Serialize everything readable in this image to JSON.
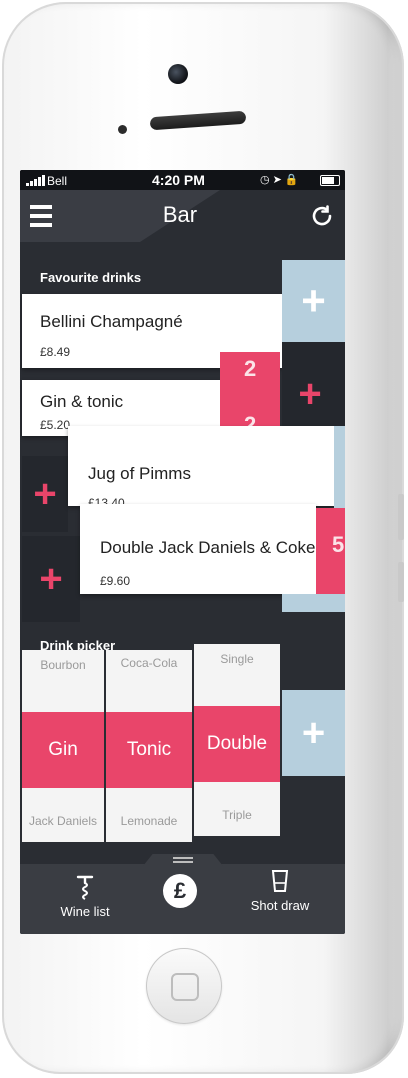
{
  "status_bar": {
    "carrier": "Bell",
    "time": "4:20 PM"
  },
  "nav": {
    "title": "Bar"
  },
  "favourites": {
    "label": "Favourite drinks",
    "items": [
      {
        "name": "Bellini Champagné",
        "price": "£8.49"
      },
      {
        "name": "Gin & tonic",
        "price": "£5.20",
        "count": "2"
      },
      {
        "name": "Jug of Pimms",
        "price": "£13.40"
      },
      {
        "name": "Double Jack Daniels & Coke",
        "price": "£9.60",
        "count": "5"
      }
    ]
  },
  "picker": {
    "label": "Drink picker",
    "columns": [
      {
        "above": "Bourbon",
        "selected": "Gin",
        "below": "Jack Daniels"
      },
      {
        "above": "Coca-Cola",
        "selected": "Tonic",
        "below": "Lemonade"
      },
      {
        "above": "Single",
        "selected": "Double",
        "below": "Triple"
      }
    ]
  },
  "tabbar": {
    "tabs": [
      {
        "label": "Wine list"
      },
      {
        "label": "Shot draw"
      }
    ]
  },
  "colors": {
    "accent": "#e9456a",
    "dark": "#2a2d33",
    "light_blue": "#b6cfdd"
  }
}
